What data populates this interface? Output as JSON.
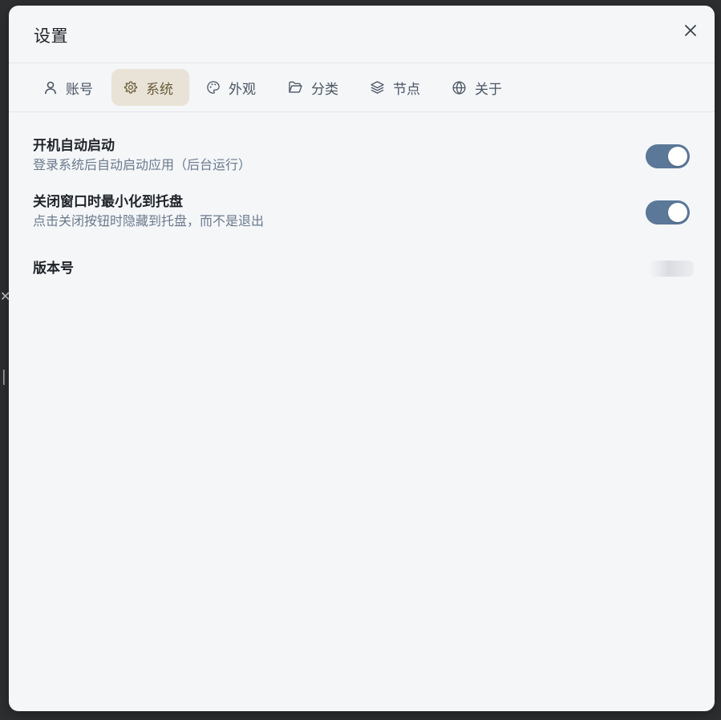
{
  "dialog": {
    "title": "设置",
    "close_icon": "close-icon"
  },
  "tabs": [
    {
      "label": "账号",
      "icon": "user-icon",
      "active": false
    },
    {
      "label": "系统",
      "icon": "gear-icon",
      "active": true
    },
    {
      "label": "外观",
      "icon": "palette-icon",
      "active": false
    },
    {
      "label": "分类",
      "icon": "folder-icon",
      "active": false
    },
    {
      "label": "节点",
      "icon": "layers-icon",
      "active": false
    },
    {
      "label": "关于",
      "icon": "globe-icon",
      "active": false
    }
  ],
  "settings": {
    "autostart": {
      "title": "开机自动启动",
      "desc": "登录系统后自动启动应用（后台运行）",
      "enabled": true
    },
    "minimize_to_tray": {
      "title": "关闭窗口时最小化到托盘",
      "desc": "点击关闭按钮时隐藏到托盘，而不是退出",
      "enabled": true
    },
    "version": {
      "title": "版本号"
    }
  },
  "colors": {
    "accent": "#5b7898",
    "active_tab_bg": "#e8e3d6",
    "active_tab_text": "#6b5b3a"
  }
}
